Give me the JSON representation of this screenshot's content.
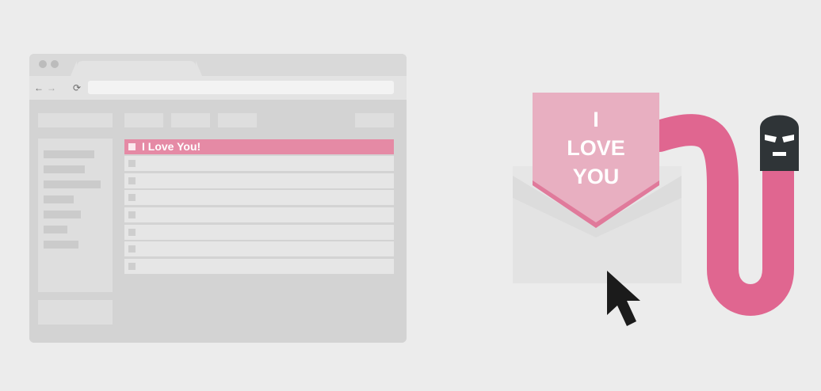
{
  "email_list": {
    "highlighted_subject": "I Love You!",
    "empty_rows": 7
  },
  "letter": {
    "lines": [
      "I",
      "LOVE",
      "YOU"
    ]
  },
  "colors": {
    "background": "#ececec",
    "browser_frame": "#d3d3d3",
    "highlight_row": "#e58aa5",
    "letter": "#e8afc1",
    "worm": "#e06690",
    "envelope": "#dcdcdc",
    "hacker_mask": "#2f3437",
    "cursor": "#1b1b1b"
  },
  "icons": {
    "back": "←",
    "forward": "→",
    "reload": "⟳"
  }
}
